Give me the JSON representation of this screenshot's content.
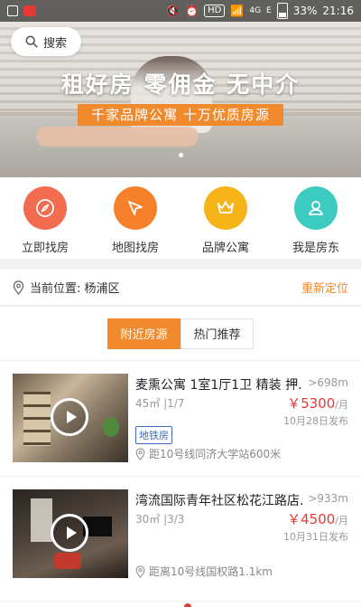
{
  "status_bar": {
    "signal_hint": "E",
    "network": "4G",
    "hd": "HD",
    "battery": "33%",
    "time": "21:16"
  },
  "search": {
    "label": "搜索"
  },
  "banner": {
    "title": "租好房 零佣金 无中介",
    "subtitle": "千家品牌公寓 十万优质房源"
  },
  "quick_nav": [
    {
      "label": "立即找房",
      "icon": "compass-icon",
      "color": "#f46c4f"
    },
    {
      "label": "地图找房",
      "icon": "pointer-icon",
      "color": "#f7802b"
    },
    {
      "label": "品牌公寓",
      "icon": "crown-icon",
      "color": "#f6b418"
    },
    {
      "label": "我是房东",
      "icon": "person-icon",
      "color": "#3ccbc0"
    }
  ],
  "location": {
    "current": "当前位置: 杨浦区",
    "action": "重新定位"
  },
  "tabs": [
    {
      "label": "附近房源",
      "active": true
    },
    {
      "label": "热门推荐",
      "active": false
    }
  ],
  "listings": [
    {
      "title": "麦熏公寓 1室1厅1卫 精装 押...",
      "distance": ">698m",
      "spec": "45㎡ |1/7",
      "price": "￥5300",
      "unit": "/月",
      "date": "10月28日发布",
      "tag": "地铁房",
      "metro": "距10号线同济大学站600米"
    },
    {
      "title": "湾流国际青年社区松花江路店...",
      "distance": ">933m",
      "spec": "30㎡ |3/3",
      "price": "￥4500",
      "unit": "/月",
      "date": "10月31日发布",
      "tag": "",
      "metro": "距离10号线国权路1.1km"
    }
  ]
}
